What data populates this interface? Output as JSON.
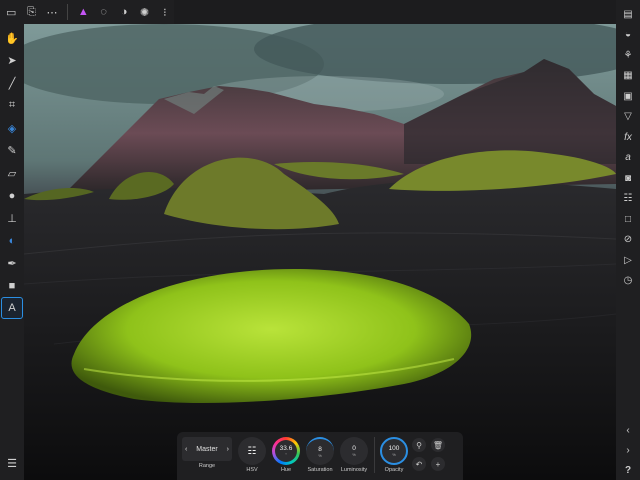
{
  "top_toolbar": {
    "icons": [
      "document-icon",
      "new-document-icon",
      "more-icon",
      "persona-photo-icon",
      "persona-liquify-icon",
      "persona-develop-icon",
      "persona-tone-map-icon",
      "persona-export-icon"
    ]
  },
  "left_tools": [
    "hand-icon",
    "move-icon",
    "eyedropper-icon",
    "crop-icon",
    "flood-fill-icon",
    "paint-brush-icon",
    "eraser-icon",
    "blur-icon",
    "clone-icon",
    "dodge-icon",
    "pen-icon",
    "shape-icon",
    "text-icon"
  ],
  "active_tool": "text-icon",
  "right_tools": [
    "layers-icon",
    "adjustments-icon",
    "brushes-icon",
    "channels-icon",
    "navigator-icon",
    "history-icon",
    "fx-icon",
    "styles-icon",
    "camera-icon",
    "sliders-icon",
    "square-icon",
    "no-entry-icon",
    "play-icon",
    "clock-icon"
  ],
  "context_bar": {
    "range_value": "Master",
    "range_label": "Range",
    "hsv_label": "HSV",
    "hue_value": "33.6",
    "hue_unit": "°",
    "hue_label": "Hue",
    "saturation_value": "8",
    "saturation_unit": "%",
    "saturation_label": "Saturation",
    "luminosity_value": "0",
    "luminosity_unit": "%",
    "luminosity_label": "Luminosity",
    "opacity_value": "100",
    "opacity_unit": "%",
    "opacity_label": "Opacity"
  },
  "help_label": "?",
  "colors": {
    "accent": "#2b8fe3",
    "panel": "#1f1f21",
    "moss": "#a6d21f"
  }
}
